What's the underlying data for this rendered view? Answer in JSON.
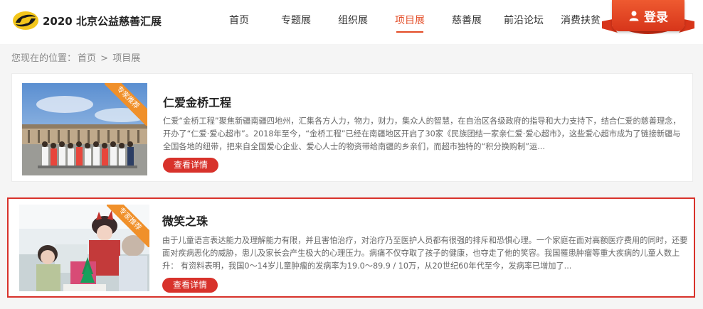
{
  "header": {
    "site_title": "2020 北京公益慈善汇展",
    "logo_icon": "swirl-logo-icon",
    "nav": [
      {
        "label": "首页",
        "active": false
      },
      {
        "label": "专题展",
        "active": false
      },
      {
        "label": "组织展",
        "active": false
      },
      {
        "label": "项目展",
        "active": true
      },
      {
        "label": "慈善展",
        "active": false
      },
      {
        "label": "前沿论坛",
        "active": false
      },
      {
        "label": "消费扶贫",
        "active": false
      }
    ],
    "login_label": "登录",
    "login_icon": "user-icon"
  },
  "breadcrumb": {
    "prefix": "您现在的位置：",
    "home": "首页",
    "separator": ">",
    "current": "项目展"
  },
  "projects": [
    {
      "badge": "专家推荐",
      "title": "仁爱金桥工程",
      "description": "仁爱“金桥工程”聚焦新疆南疆四地州，汇集各方人力，物力，财力，集众人的智慧，在自治区各级政府的指导和大力支持下，结合仁爱的慈善理念，开办了“仁爱·爱心超市”。2018年至今，“金桥工程”已经在南疆地区开启了30家《民族团结一家亲仁爱·爱心超市》，这些爱心超市成为了链接新疆与全国各地的纽带，把来自全国爱心企业、爱心人士的物资带给南疆的乡亲们，而超市独特的“积分换购制”运...",
      "detail_label": "查看详情"
    },
    {
      "badge": "专家推荐",
      "title": "微笑之珠",
      "description": "由于儿童语言表达能力及理解能力有限，并且害怕治疗，对治疗乃至医护人员都有很强的排斥和恐惧心理。一个家庭在面对高额医疗费用的同时，还要面对疾病恶化的威胁，患儿及家长会产生极大的心理压力。病痛不仅夺取了孩子的健康，也夺走了他的笑容。我国罹患肿瘤等重大疾病的儿童人数上升： 有资料表明，我国0～14岁儿童肿瘤的发病率为19.0～89.9 / 10万，从20世纪60年代至今，发病率已增加了...",
      "detail_label": "查看详情"
    }
  ],
  "colors": {
    "accent": "#d8322b",
    "nav_active": "#e34b25",
    "badge": "#f0902a",
    "login_gradient_top": "#ee5a30",
    "login_gradient_bottom": "#d7351a"
  }
}
